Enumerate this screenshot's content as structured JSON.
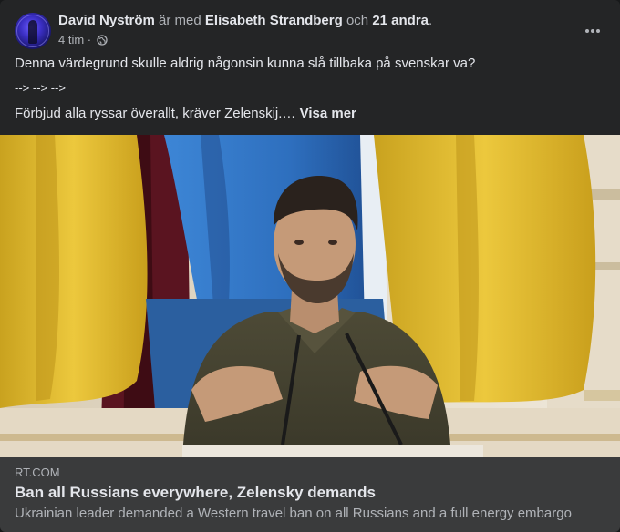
{
  "post": {
    "author": "David Nyström",
    "with_text": "är med",
    "tagged": "Elisabeth Strandberg",
    "and_text": "och",
    "others": "21 andra",
    "period": ".",
    "time": "4 tim",
    "separator": "·",
    "privacy_icon": "globe-icon",
    "more_icon": "more-options-icon",
    "lines": [
      "Denna värdegrund skulle aldrig någonsin kunna slå tillbaka på svenskar va?",
      "--> --> -->",
      "Förbjud alla ryssar överallt, kräver Zelenskij.…"
    ],
    "see_more": "Visa mer"
  },
  "link_preview": {
    "domain": "RT.COM",
    "title": "Ban all Russians everywhere, Zelensky demands",
    "description": "Ukrainian leader demanded a Western travel ban on all Russians and a full energy embargo"
  },
  "colors": {
    "card_bg": "#242526",
    "preview_bg": "#3a3b3c",
    "text_primary": "#e4e6eb",
    "text_secondary": "#b0b3b8",
    "flag_yellow": "#e7c23b",
    "flag_blue": "#2f6fc0"
  }
}
